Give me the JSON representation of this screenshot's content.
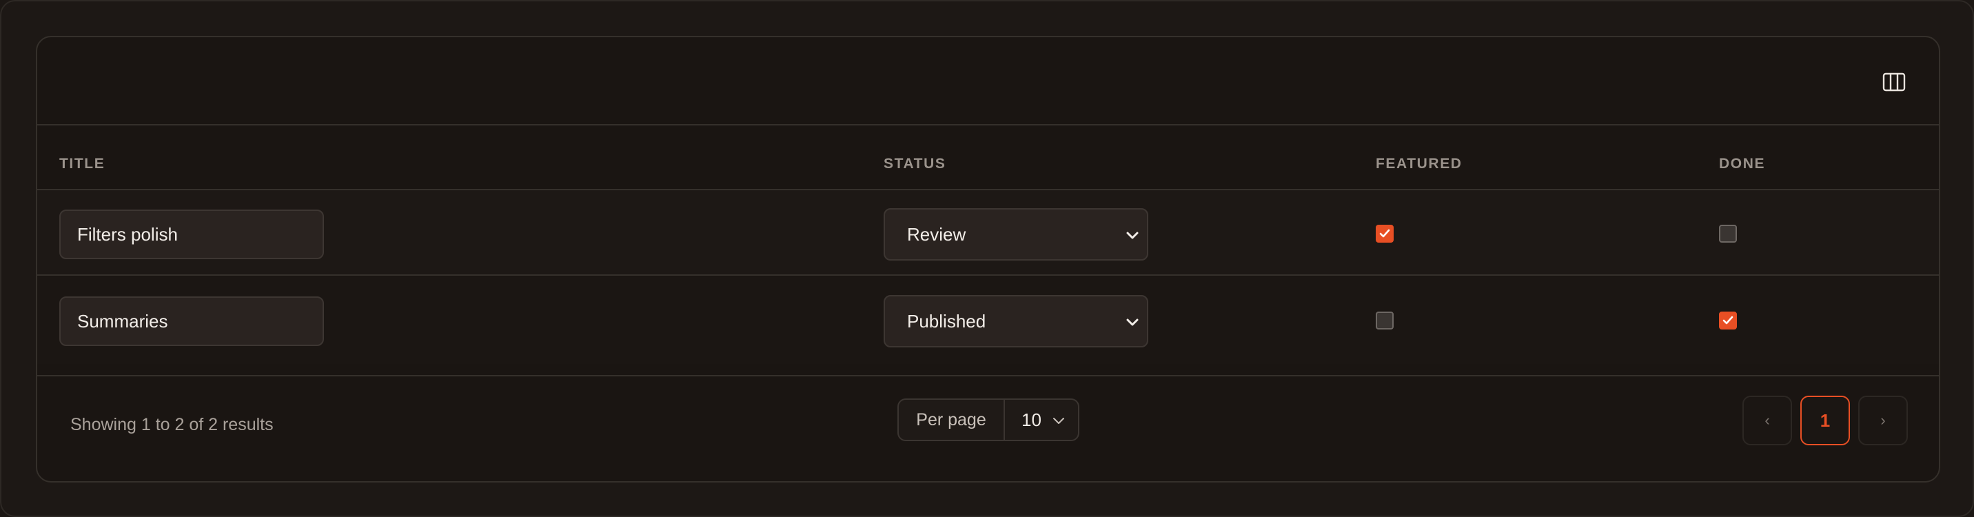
{
  "table": {
    "headers": {
      "title": "Title",
      "status": "Status",
      "featured": "Featured",
      "done": "Done"
    },
    "rows": [
      {
        "title": "Filters polish",
        "status": "Review",
        "featured": true,
        "done": false
      },
      {
        "title": "Summaries",
        "status": "Published",
        "featured": false,
        "done": true
      }
    ]
  },
  "footer": {
    "summary": "Showing 1 to 2 of 2 results",
    "per_page_label": "Per page",
    "per_page_value": "10",
    "pagination": {
      "prev": "‹",
      "current": "1",
      "next": "›"
    }
  },
  "colors": {
    "accent": "#e84f24",
    "background": "#1a1512",
    "border": "#35302b"
  },
  "icons": {
    "toolbar": "columns-icon",
    "select": "chevron-down-icon"
  }
}
